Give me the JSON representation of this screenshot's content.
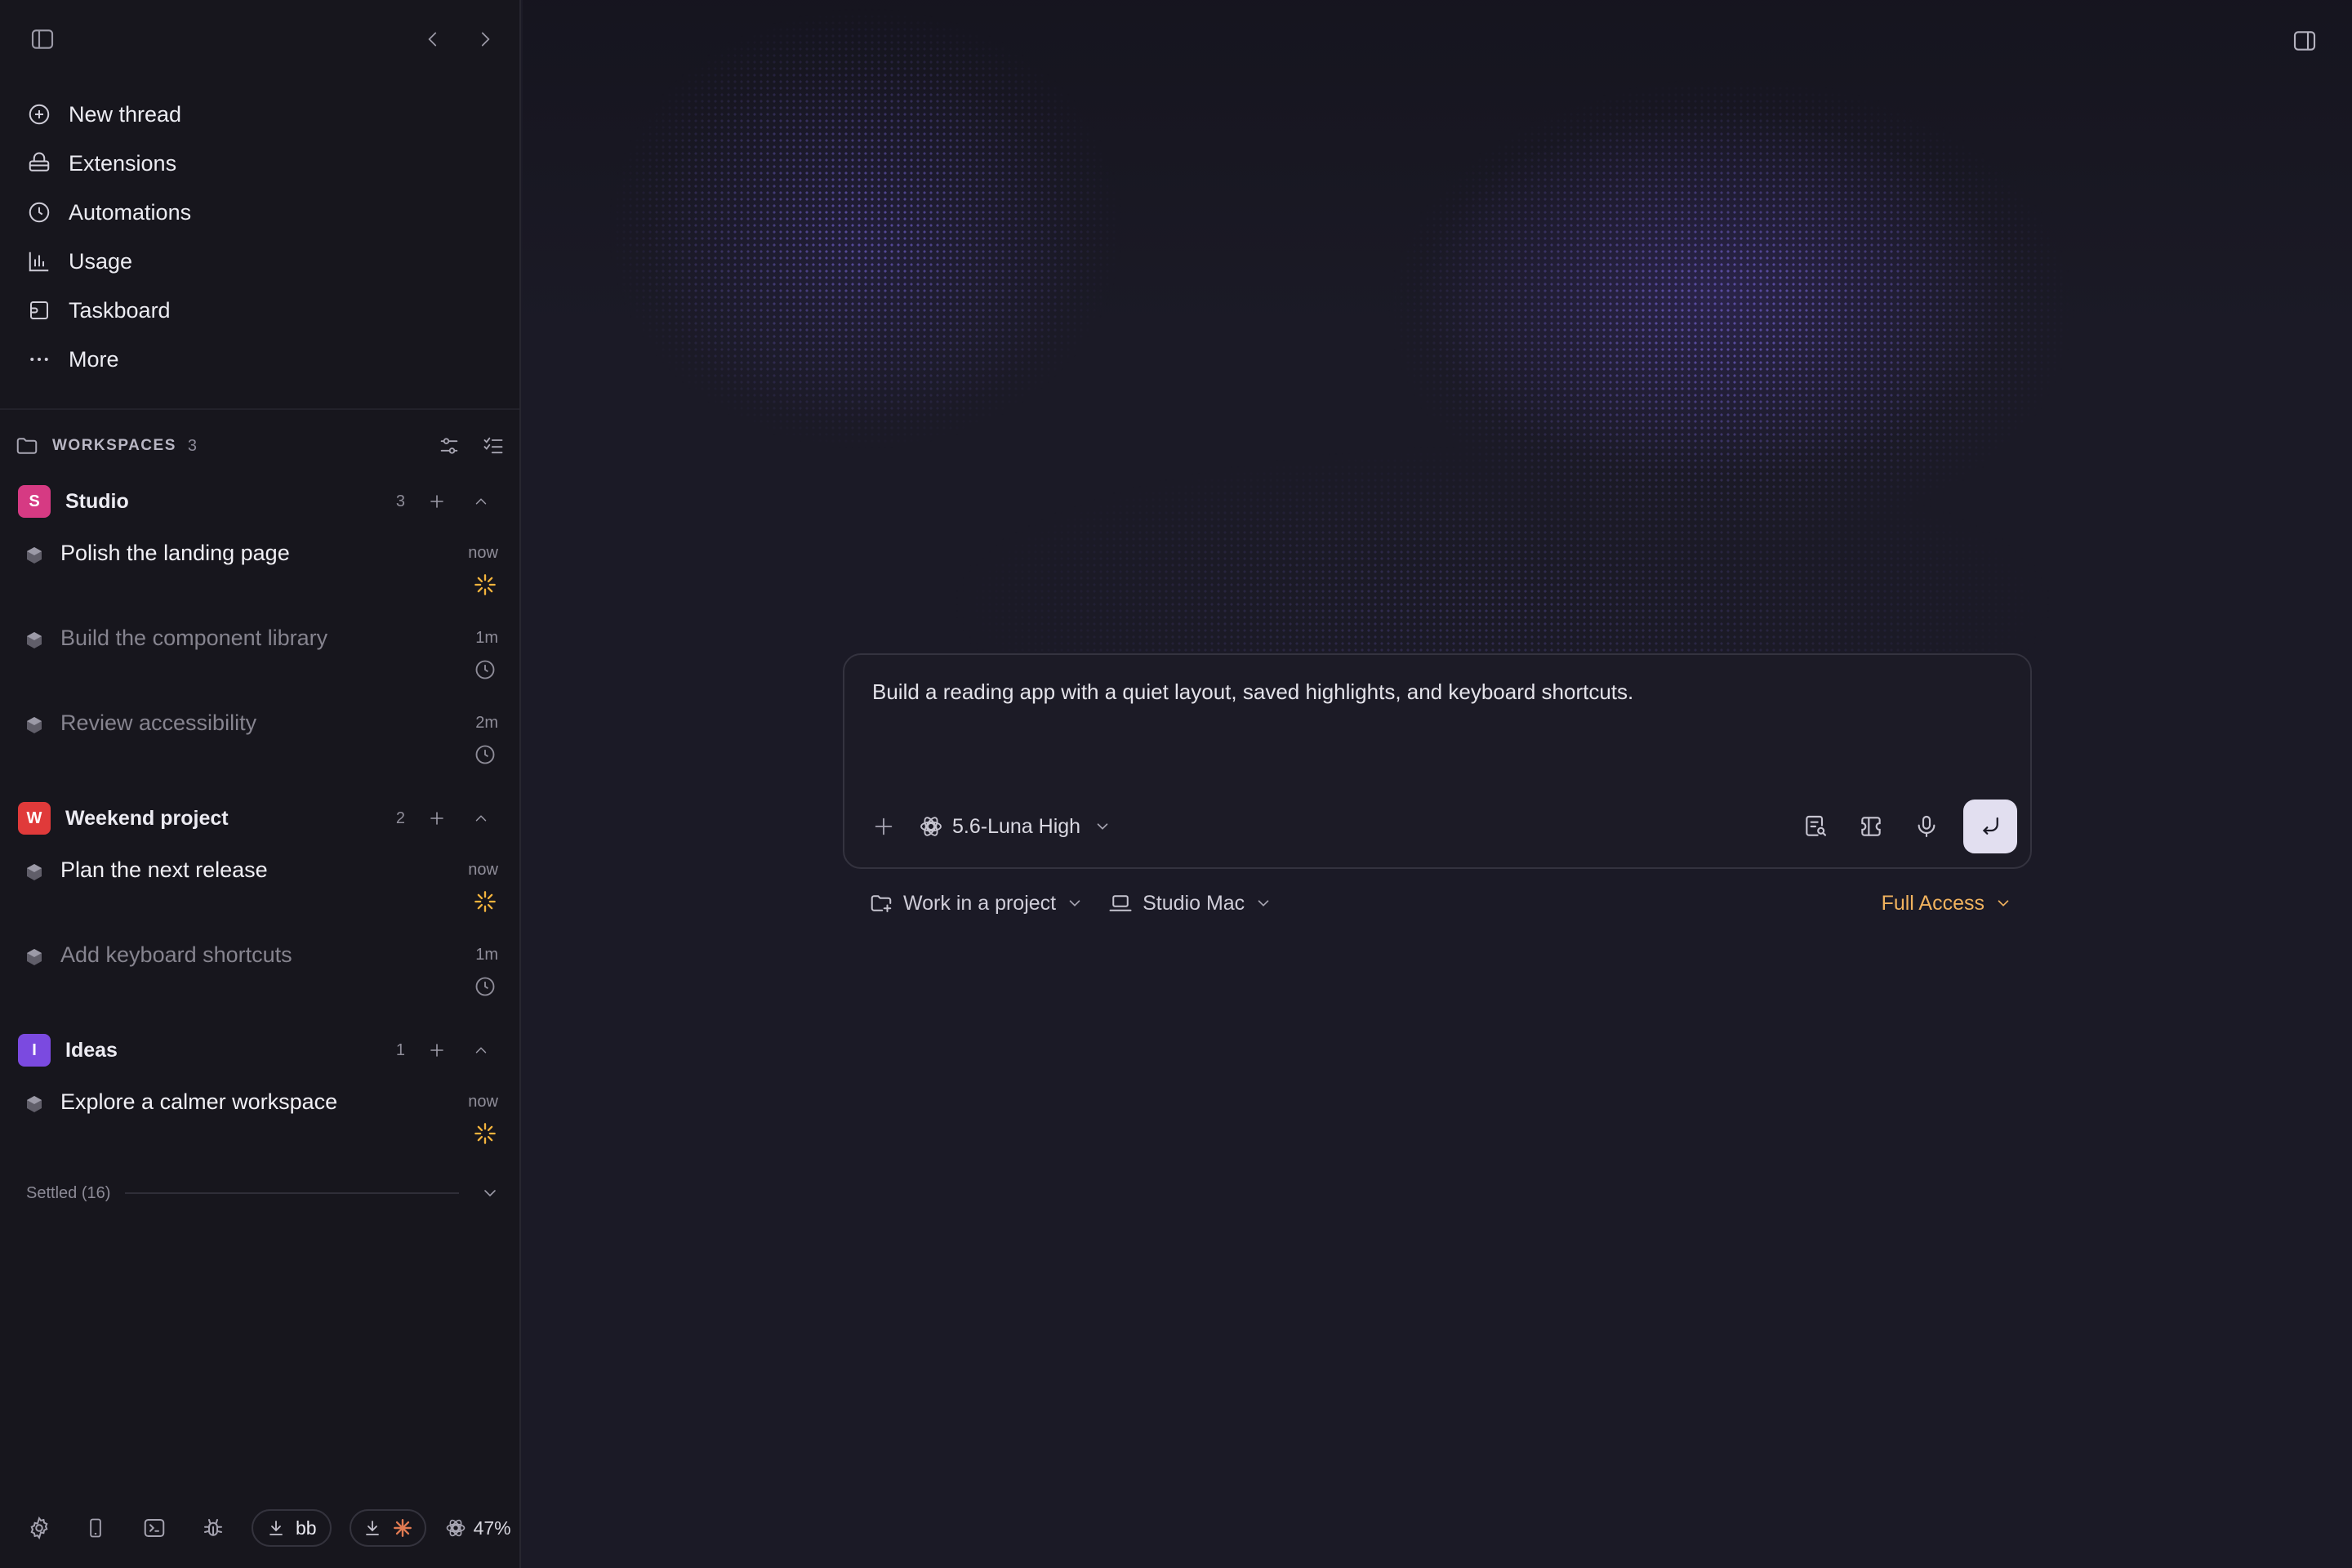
{
  "sidebar": {
    "nav": [
      {
        "label": "New thread",
        "icon": "plus-circle-icon"
      },
      {
        "label": "Extensions",
        "icon": "extensions-icon"
      },
      {
        "label": "Automations",
        "icon": "clock-icon"
      },
      {
        "label": "Usage",
        "icon": "bar-chart-icon"
      },
      {
        "label": "Taskboard",
        "icon": "taskboard-icon"
      },
      {
        "label": "More",
        "icon": "more-icon"
      }
    ],
    "workspaces": {
      "label": "WORKSPACES",
      "count": "3"
    },
    "groups": [
      {
        "badge": "S",
        "name": "Studio",
        "count": "3",
        "color": "#d63a83",
        "threads": [
          {
            "title": "Polish the landing page",
            "time": "now",
            "status": "running"
          },
          {
            "title": "Build the component library",
            "time": "1m",
            "status": "queued"
          },
          {
            "title": "Review accessibility",
            "time": "2m",
            "status": "queued"
          }
        ]
      },
      {
        "badge": "W",
        "name": "Weekend project",
        "count": "2",
        "color": "#e03a3a",
        "threads": [
          {
            "title": "Plan the next release",
            "time": "now",
            "status": "running"
          },
          {
            "title": "Add keyboard shortcuts",
            "time": "1m",
            "status": "queued"
          }
        ]
      },
      {
        "badge": "I",
        "name": "Ideas",
        "count": "1",
        "color": "#7b4ae0",
        "threads": [
          {
            "title": "Explore a calmer workspace",
            "time": "now",
            "status": "running"
          }
        ]
      }
    ],
    "settled": "Settled (16)",
    "bottom": {
      "download_label": "bb",
      "usage": "47%"
    }
  },
  "composer": {
    "prompt": "Build a reading app with a quiet layout, saved highlights, and keyboard shortcuts.",
    "model": "5.6-Luna High"
  },
  "options": {
    "project": "Work in a project",
    "machine": "Studio Mac",
    "access": "Full Access"
  },
  "colors": {
    "accent_orange": "#f0b25e",
    "spinner": "#f2b33d",
    "background": "#1b1a26",
    "sidebar": "#17161d"
  }
}
